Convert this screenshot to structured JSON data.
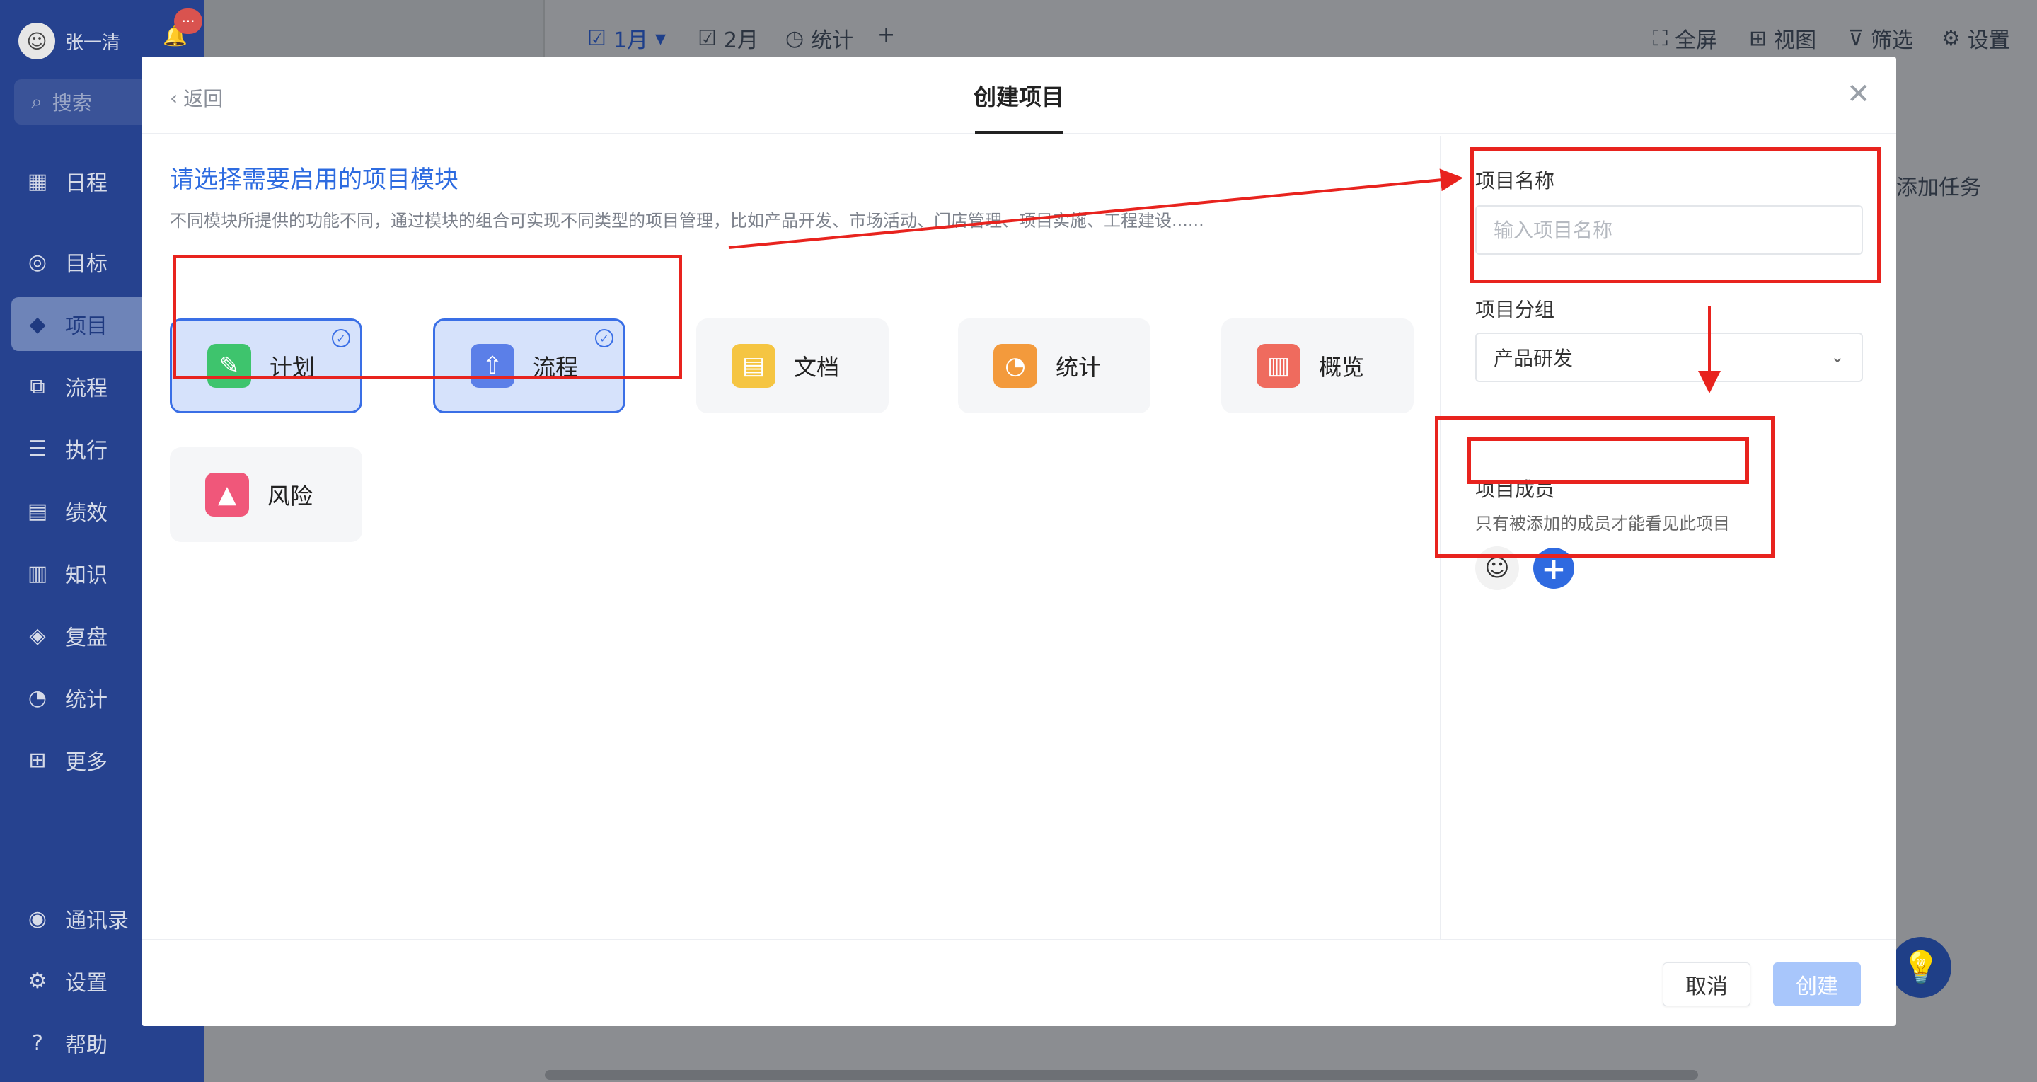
{
  "app": {
    "user_name": "张一清",
    "notification_badge": "···",
    "search_placeholder": "搜索",
    "nav": [
      {
        "label": "日程",
        "icon": "calendar-icon"
      },
      {
        "label": "目标",
        "icon": "target-icon"
      },
      {
        "label": "项目",
        "icon": "cube-icon"
      },
      {
        "label": "流程",
        "icon": "flow-icon"
      },
      {
        "label": "执行",
        "icon": "list-icon"
      },
      {
        "label": "绩效",
        "icon": "chart-icon"
      },
      {
        "label": "知识",
        "icon": "book-icon"
      },
      {
        "label": "复盘",
        "icon": "review-icon"
      },
      {
        "label": "统计",
        "icon": "pie-icon"
      },
      {
        "label": "更多",
        "icon": "grid-icon"
      },
      {
        "label": "通讯录",
        "icon": "contacts-icon"
      },
      {
        "label": "设置",
        "icon": "gear-icon"
      },
      {
        "label": "帮助",
        "icon": "help-icon"
      }
    ],
    "topbar": {
      "tab_jan": "1月",
      "tab_feb": "2月",
      "tab_stats": "统计",
      "add": "+",
      "fullscreen": "全屏",
      "view": "视图",
      "filter": "筛选",
      "settings": "设置"
    },
    "right_strip_text": "添加任务"
  },
  "modal": {
    "back_label": "返回",
    "title": "创建项目",
    "section_title": "请选择需要启用的项目模块",
    "section_desc": "不同模块所提供的功能不同，通过模块的组合可实现不同类型的项目管理，比如产品开发、市场活动、门店管理、项目实施、工程建设......",
    "modules": [
      {
        "label": "计划",
        "selected": true,
        "color": "#3ec46d",
        "icon": "plan-icon"
      },
      {
        "label": "流程",
        "selected": true,
        "color": "#5b7fe8",
        "icon": "flow-icon"
      },
      {
        "label": "文档",
        "selected": false,
        "color": "#f5c542",
        "icon": "document-icon"
      },
      {
        "label": "统计",
        "selected": false,
        "color": "#f39a3c",
        "icon": "pie-icon"
      },
      {
        "label": "概览",
        "selected": false,
        "color": "#ef6b5e",
        "icon": "overview-icon"
      },
      {
        "label": "风险",
        "selected": false,
        "color": "#f0577a",
        "icon": "risk-icon"
      }
    ],
    "form": {
      "name_label": "项目名称",
      "name_placeholder": "输入项目名称",
      "group_label": "项目分组",
      "group_value": "产品研发",
      "members_label": "项目成员",
      "members_hint": "只有被添加的成员才能看见此项目"
    },
    "cancel_label": "取消",
    "create_label": "创建"
  },
  "colors": {
    "accent": "#2f6ae0",
    "annotation_red": "#e8231e",
    "sidebar": "#26428f"
  }
}
